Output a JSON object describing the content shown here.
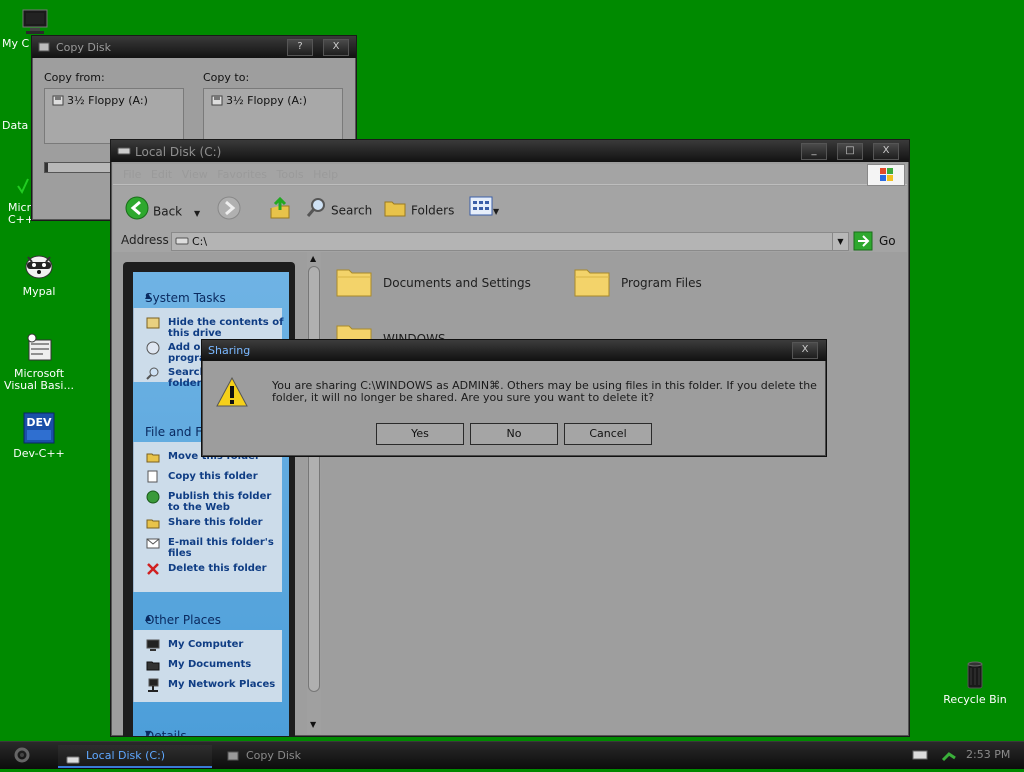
{
  "desktop": {
    "icons": [
      {
        "label": "My C"
      },
      {
        "label": "Data"
      },
      {
        "label": "Micr Visual C++"
      },
      {
        "label": "Mypal"
      },
      {
        "label": "Microsoft Visual Basi..."
      },
      {
        "label": "Dev-C++"
      },
      {
        "label": "Recycle Bin"
      }
    ],
    "background": "#008a00"
  },
  "copy_disk": {
    "title": "Copy Disk",
    "copy_from_label": "Copy from:",
    "copy_to_label": "Copy to:",
    "from_item": "3½ Floppy (A:)",
    "to_item": "3½ Floppy (A:)",
    "help_btn": "?",
    "close_btn": "X"
  },
  "explorer": {
    "title": "Local Disk (C:)",
    "menubar_text": "File  Edit  View  Favorites  Tools  Help",
    "toolbar": {
      "back": "Back",
      "search": "Search",
      "folders": "Folders"
    },
    "address": {
      "label": "Address",
      "value": "C:\\",
      "go": "Go"
    },
    "sidebar": {
      "system_tasks": {
        "title": "System Tasks",
        "items": [
          "Hide the contents of this drive",
          "Add or remove programs",
          "Search for files or folders"
        ]
      },
      "file_folder_tasks": {
        "title": "File and Folder Tasks",
        "items": [
          "Move this folder",
          "Copy this folder",
          "Publish this folder to the Web",
          "Share this folder",
          "E-mail this folder's files",
          "Delete this folder"
        ]
      },
      "other_places": {
        "title": "Other Places",
        "items": [
          "My Computer",
          "My Documents",
          "My Network Places"
        ]
      },
      "details": {
        "title": "Details"
      }
    },
    "folders": [
      "Documents and Settings",
      "Program Files",
      "WINDOWS"
    ],
    "window_buttons": [
      "_",
      "□",
      "X"
    ]
  },
  "sharing_dialog": {
    "title": "Sharing",
    "message": "You are sharing C:\\WINDOWS as ADMIN⌘. Others may be using files in this folder. If you delete the folder, it will no longer be shared. Are you sure you want to delete it?",
    "buttons": {
      "yes": "Yes",
      "no": "No",
      "cancel": "Cancel"
    },
    "close_btn": "X",
    "icon": "warning-icon"
  },
  "taskbar": {
    "items": [
      {
        "label": "Local Disk (C:)",
        "active": true
      },
      {
        "label": "Copy Disk",
        "active": false
      }
    ],
    "clock": "2:53 PM"
  }
}
